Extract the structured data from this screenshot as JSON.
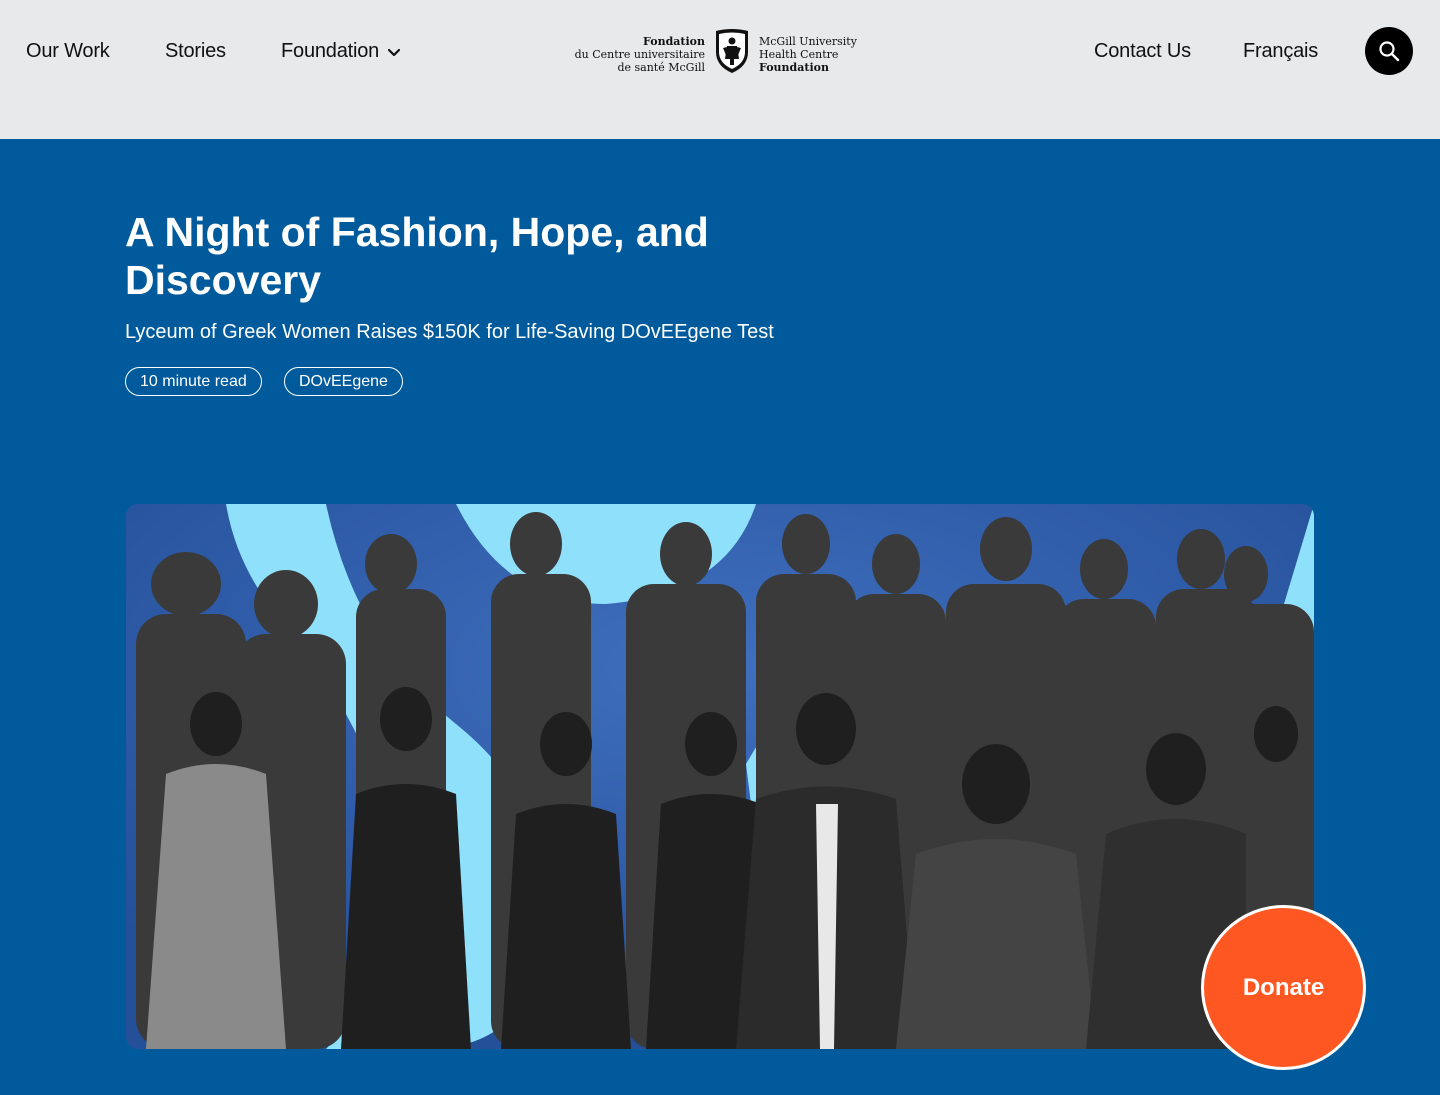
{
  "nav": {
    "our_work": "Our Work",
    "stories": "Stories",
    "foundation": "Foundation",
    "contact": "Contact Us",
    "language": "Français"
  },
  "logo": {
    "fr_line1": "Fondation",
    "fr_line2": "du Centre universitaire",
    "fr_line3": "de santé McGill",
    "en_line1": "McGill University",
    "en_line2": "Health Centre",
    "en_line3": "Foundation"
  },
  "article": {
    "title": "A Night of Fashion, Hope, and Discovery",
    "subtitle": "Lyceum of Greek Women Raises $150K for Life-Saving DOvEEgene Test",
    "read_time": "10 minute read",
    "topic_tag": "DOvEEgene"
  },
  "donate_label": "Donate",
  "colors": {
    "header_bg": "#e8e9eb",
    "page_bg": "#005a9c",
    "accent_light_blue": "#8ee0fb",
    "donate": "#ff5722"
  },
  "icons": {
    "search": "search-icon",
    "chevron": "chevron-down-icon",
    "logo": "mcgill-shield-icon"
  }
}
